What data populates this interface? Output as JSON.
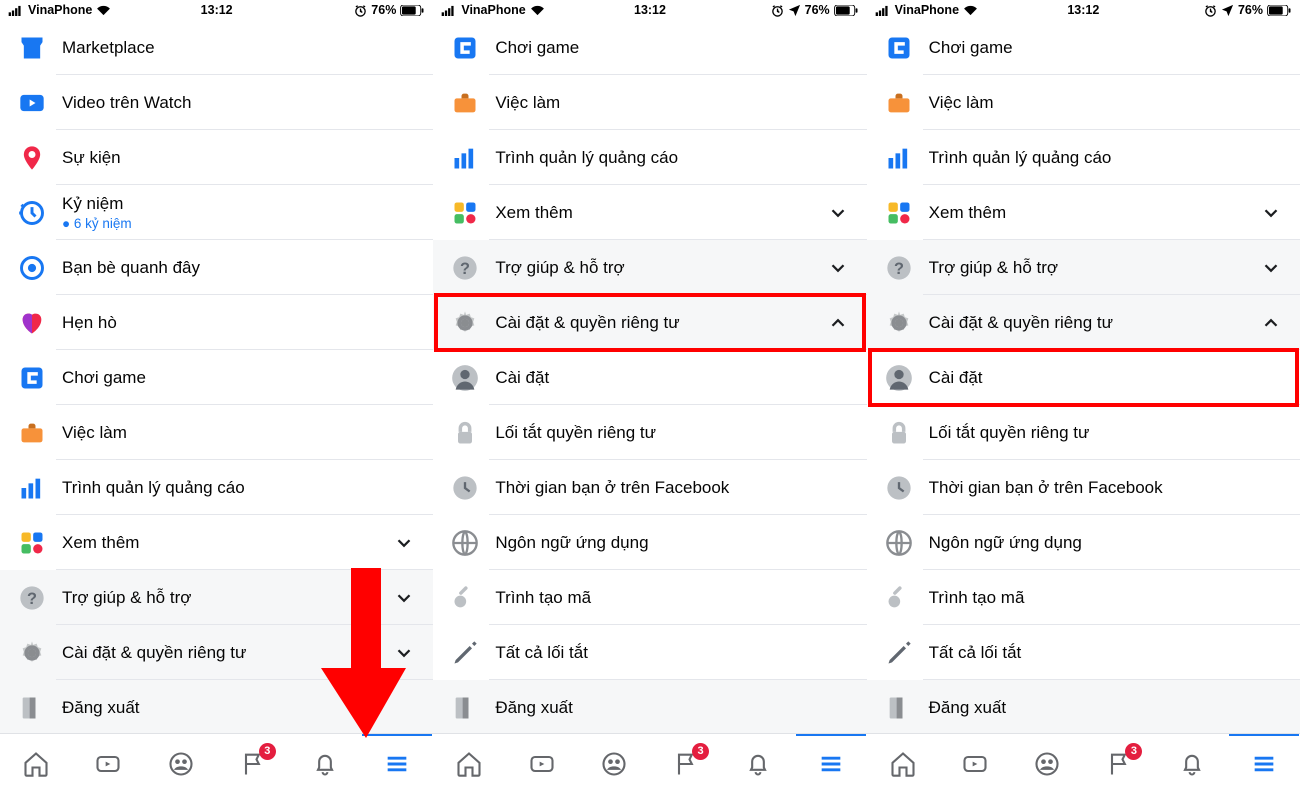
{
  "status": {
    "carrier": "VinaPhone",
    "time": "13:12",
    "battery": "76%"
  },
  "badge": "3",
  "screen1": {
    "items": [
      {
        "icon": "marketplace",
        "label": "Marketplace"
      },
      {
        "icon": "watch",
        "label": "Video trên Watch"
      },
      {
        "icon": "events",
        "label": "Sự kiện"
      },
      {
        "icon": "memories",
        "label": "Kỷ niệm",
        "sub": "● 6 kỷ niệm"
      },
      {
        "icon": "nearby",
        "label": "Bạn bè quanh đây"
      },
      {
        "icon": "dating",
        "label": "Hẹn hò"
      },
      {
        "icon": "gaming",
        "label": "Chơi game"
      },
      {
        "icon": "jobs",
        "label": "Việc làm"
      },
      {
        "icon": "ads",
        "label": "Trình quản lý quảng cáo"
      },
      {
        "icon": "seemore",
        "label": "Xem thêm",
        "chev": "down"
      }
    ],
    "gray": [
      {
        "icon": "help",
        "label": "Trợ giúp & hỗ trợ",
        "chev": "down"
      },
      {
        "icon": "settings",
        "label": "Cài đặt & quyền riêng tư",
        "chev": "down"
      },
      {
        "icon": "logout",
        "label": "Đăng xuất"
      }
    ]
  },
  "screen2": {
    "items": [
      {
        "icon": "gaming",
        "label": "Chơi game"
      },
      {
        "icon": "jobs",
        "label": "Việc làm"
      },
      {
        "icon": "ads",
        "label": "Trình quản lý quảng cáo"
      },
      {
        "icon": "seemore",
        "label": "Xem thêm",
        "chev": "down"
      }
    ],
    "gray": [
      {
        "icon": "help",
        "label": "Trợ giúp & hỗ trợ",
        "chev": "down"
      },
      {
        "icon": "settings",
        "label": "Cài đặt & quyền riêng tư",
        "chev": "up",
        "hl": true
      }
    ],
    "sub": [
      {
        "icon": "person",
        "label": "Cài đặt"
      },
      {
        "icon": "lock",
        "label": "Lối tắt quyền riêng tư"
      },
      {
        "icon": "clock",
        "label": "Thời gian bạn ở trên Facebook"
      },
      {
        "icon": "globe",
        "label": "Ngôn ngữ ứng dụng"
      },
      {
        "icon": "key",
        "label": "Trình tạo mã"
      },
      {
        "icon": "pencil",
        "label": "Tất cả lối tắt"
      }
    ],
    "after": [
      {
        "icon": "logout",
        "label": "Đăng xuất"
      }
    ]
  },
  "screen3": {
    "items": [
      {
        "icon": "gaming",
        "label": "Chơi game"
      },
      {
        "icon": "jobs",
        "label": "Việc làm"
      },
      {
        "icon": "ads",
        "label": "Trình quản lý quảng cáo"
      },
      {
        "icon": "seemore",
        "label": "Xem thêm",
        "chev": "down"
      }
    ],
    "gray": [
      {
        "icon": "help",
        "label": "Trợ giúp & hỗ trợ",
        "chev": "down"
      },
      {
        "icon": "settings",
        "label": "Cài đặt & quyền riêng tư",
        "chev": "up"
      }
    ],
    "sub": [
      {
        "icon": "person",
        "label": "Cài đặt",
        "hl": true
      },
      {
        "icon": "lock",
        "label": "Lối tắt quyền riêng tư"
      },
      {
        "icon": "clock",
        "label": "Thời gian bạn ở trên Facebook"
      },
      {
        "icon": "globe",
        "label": "Ngôn ngữ ứng dụng"
      },
      {
        "icon": "key",
        "label": "Trình tạo mã"
      },
      {
        "icon": "pencil",
        "label": "Tất cả lối tắt"
      }
    ],
    "after": [
      {
        "icon": "logout",
        "label": "Đăng xuất"
      }
    ]
  }
}
